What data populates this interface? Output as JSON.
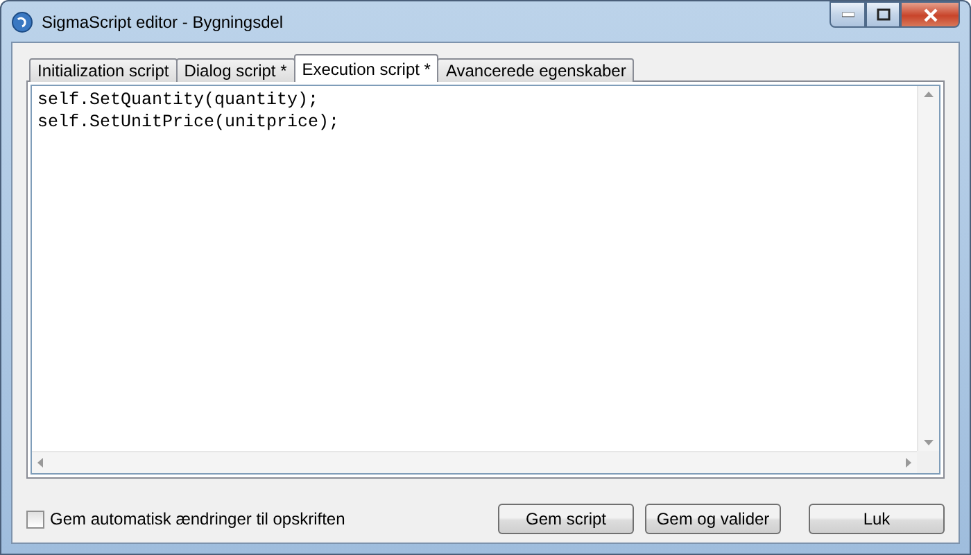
{
  "window": {
    "title": "SigmaScript editor - Bygningsdel"
  },
  "tabs": [
    {
      "label": "Initialization script",
      "selected": false
    },
    {
      "label": "Dialog script *",
      "selected": false
    },
    {
      "label": "Execution script *",
      "selected": true
    },
    {
      "label": "Avancerede egenskaber",
      "selected": false
    }
  ],
  "editor": {
    "lines": [
      "self.SetQuantity(quantity);",
      "self.SetUnitPrice(unitprice);"
    ]
  },
  "auto_save": {
    "label": "Gem automatisk ændringer til opskriften",
    "checked": false
  },
  "buttons": [
    "Gem script",
    "Gem og valider",
    "Luk"
  ]
}
